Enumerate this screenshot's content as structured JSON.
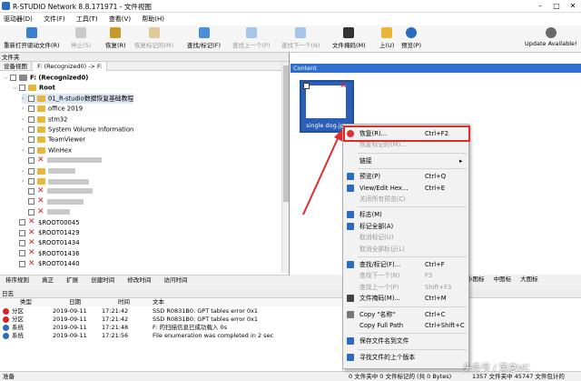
{
  "window": {
    "title": "R-STUDIO Network 8.8.171971 - 文件视图"
  },
  "menu": [
    "驱动器(D)",
    "文件(F)",
    "工具(T)",
    "查看(V)",
    "帮助(H)"
  ],
  "toolbar": [
    {
      "label": "重新打开驱动文件(R)",
      "icon": "refresh-icon",
      "enabled": true
    },
    {
      "label": "停止(S)",
      "icon": "stop-icon",
      "enabled": false
    },
    {
      "label": "恢复(R)",
      "icon": "recover-icon",
      "enabled": true
    },
    {
      "label": "恢复标记的(M)",
      "icon": "recover-marked-icon",
      "enabled": false
    },
    {
      "label": "查找/标记(F)",
      "icon": "find-icon",
      "enabled": true
    },
    {
      "label": "查找上一个(P)",
      "icon": "find-prev-icon",
      "enabled": false
    },
    {
      "label": "查找下一个(N)",
      "icon": "find-next-icon",
      "enabled": false
    },
    {
      "label": "文件掩码(M)",
      "icon": "mask-icon",
      "enabled": true
    },
    {
      "label": "上(U)",
      "icon": "up-icon",
      "enabled": true
    },
    {
      "label": "预览(P)",
      "icon": "preview-icon",
      "enabled": true
    }
  ],
  "update_label": "Update Available!",
  "left_pane": {
    "header": "文件夹",
    "tabs": [
      "设备视图",
      "F: (Recognized0) -> F:"
    ],
    "tree": [
      {
        "label": "F: (Recognized0)",
        "level": 0,
        "bold": true
      },
      {
        "label": "Root",
        "level": 1,
        "bold": true
      },
      {
        "label": "01_R-studio数据恢复基础教程",
        "level": 2,
        "selected": true
      },
      {
        "label": "office 2019",
        "level": 2
      },
      {
        "label": "stm32",
        "level": 2
      },
      {
        "label": "System Volume Information",
        "level": 2
      },
      {
        "label": "TeamViewer",
        "level": 2
      },
      {
        "label": "WinHex",
        "level": 2
      },
      {
        "label": "",
        "level": 2,
        "deleted": true,
        "blur": 60
      },
      {
        "label": "",
        "level": 2,
        "blur": 30
      },
      {
        "label": "",
        "level": 2,
        "blur": 45
      },
      {
        "label": "",
        "level": 2,
        "deleted": true,
        "blur": 50
      },
      {
        "label": "",
        "level": 2,
        "deleted": true,
        "blur": 40
      },
      {
        "label": "",
        "level": 2,
        "deleted": true,
        "blur": 25
      },
      {
        "label": "$ROOT00045",
        "level": 1,
        "deleted": true
      },
      {
        "label": "$ROOT01429",
        "level": 1,
        "deleted": true
      },
      {
        "label": "$ROOT01434",
        "level": 1,
        "deleted": true
      },
      {
        "label": "$ROOT01436",
        "level": 1,
        "deleted": true
      },
      {
        "label": "$ROOT01440",
        "level": 1,
        "deleted": true
      }
    ]
  },
  "sort_tabs": [
    "排序规则",
    "真正",
    "扩展",
    "创建时间",
    "修改时间",
    "访问时间"
  ],
  "view_buttons": [
    "小图标",
    "中图标",
    "大图标"
  ],
  "content": {
    "header": "Content",
    "file_name": "single dog.jpg"
  },
  "log": {
    "header": "日志",
    "columns": [
      "类型",
      "日期",
      "时间",
      "文本"
    ],
    "rows": [
      {
        "type": "分区",
        "date": "2019-09-11",
        "time": "17:21:42",
        "text": "SSD R0831B0: GPT tables error 0x1",
        "kind": "error"
      },
      {
        "type": "分区",
        "date": "2019-09-11",
        "time": "17:21:42",
        "text": "SSD R0831B0: GPT tables error 0x1",
        "kind": "error"
      },
      {
        "type": "系统",
        "date": "2019-09-11",
        "time": "17:21:48",
        "text": "F: 的扫描信息已成功载入 0s",
        "kind": "info"
      },
      {
        "type": "系统",
        "date": "2019-09-11",
        "time": "17:21:56",
        "text": "File enumeration was completed in 2 sec",
        "kind": "info"
      }
    ]
  },
  "status": {
    "left": "准备",
    "middle": "0 文件夹中 0 文件标记的 (共 0 Bytes)",
    "right": "1357 文件夹中 45747 文件包计的 24.15 GB"
  },
  "context_menu": [
    {
      "label": "恢复(R)...",
      "shortcut": "Ctrl+F2",
      "enabled": true,
      "icon": "recover-icon",
      "highlight": true
    },
    {
      "label": "恢复标记的(M)...",
      "shortcut": "",
      "enabled": false,
      "icon": ""
    },
    {
      "sep": true
    },
    {
      "label": "链接",
      "shortcut": "",
      "enabled": true,
      "submenu": true
    },
    {
      "sep": true
    },
    {
      "label": "预览(P)",
      "shortcut": "Ctrl+Q",
      "enabled": true,
      "icon": "preview-icon"
    },
    {
      "label": "View/Edit Hex...",
      "shortcut": "Ctrl+E",
      "enabled": true,
      "icon": "hex-icon"
    },
    {
      "label": "关闭所有预览(C)",
      "shortcut": "",
      "enabled": false,
      "icon": ""
    },
    {
      "sep": true
    },
    {
      "label": "标志(M)",
      "shortcut": "",
      "enabled": true,
      "icon": "check-icon"
    },
    {
      "label": "标记全部(A)",
      "shortcut": "",
      "enabled": true,
      "icon": "check-all-icon"
    },
    {
      "label": "取消标记(U)",
      "shortcut": "",
      "enabled": false,
      "icon": ""
    },
    {
      "label": "取消全部标记(L)",
      "shortcut": "",
      "enabled": false,
      "icon": ""
    },
    {
      "sep": true
    },
    {
      "label": "查找/标记(F)...",
      "shortcut": "Ctrl+F",
      "enabled": true,
      "icon": "find-icon"
    },
    {
      "label": "查找下一个(N)",
      "shortcut": "F3",
      "enabled": false,
      "icon": ""
    },
    {
      "label": "查找上一个(P)",
      "shortcut": "Shift+F3",
      "enabled": false,
      "icon": ""
    },
    {
      "label": "文件掩码(M)...",
      "shortcut": "Ctrl+M",
      "enabled": true,
      "icon": "mask-icon"
    },
    {
      "sep": true
    },
    {
      "label": "Copy \"名称\"",
      "shortcut": "Ctrl+C",
      "enabled": true,
      "icon": "copy-icon"
    },
    {
      "label": "Copy Full Path",
      "shortcut": "Ctrl+Shift+C",
      "enabled": true,
      "icon": ""
    },
    {
      "sep": true
    },
    {
      "label": "保存文件名到文件",
      "shortcut": "",
      "enabled": true,
      "icon": "save-icon"
    },
    {
      "sep": true
    },
    {
      "label": "寻找文件的上个版本",
      "shortcut": "",
      "enabled": true,
      "icon": "history-icon"
    }
  ],
  "watermark": "头条号 / 黄总VC",
  "colors": {
    "accent": "#2f6fd0",
    "highlight": "#e02b2b",
    "thumb_bg": "#2b5fb5"
  }
}
